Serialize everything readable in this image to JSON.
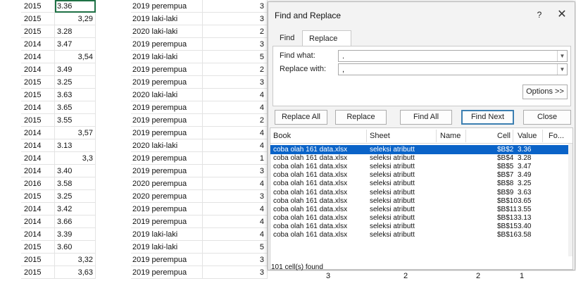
{
  "spreadsheet": {
    "rows": [
      {
        "a": "2015",
        "b": "3.36",
        "b_align": "left",
        "d": "2019 perempua",
        "e": "3"
      },
      {
        "a": "2015",
        "b": "3,29",
        "b_align": "right",
        "d": "2019 laki-laki",
        "e": "3"
      },
      {
        "a": "2015",
        "b": "3.28",
        "b_align": "left",
        "d": "2020 laki-laki",
        "e": "2"
      },
      {
        "a": "2014",
        "b": "3.47",
        "b_align": "left",
        "d": "2019 perempua",
        "e": "3"
      },
      {
        "a": "2014",
        "b": "3,54",
        "b_align": "right",
        "d": "2019 laki-laki",
        "e": "5"
      },
      {
        "a": "2014",
        "b": "3.49",
        "b_align": "left",
        "d": "2019 perempua",
        "e": "2"
      },
      {
        "a": "2015",
        "b": "3.25",
        "b_align": "left",
        "d": "2019 perempua",
        "e": "3"
      },
      {
        "a": "2015",
        "b": "3.63",
        "b_align": "left",
        "d": "2020 laki-laki",
        "e": "4"
      },
      {
        "a": "2014",
        "b": "3.65",
        "b_align": "left",
        "d": "2019 perempua",
        "e": "4"
      },
      {
        "a": "2015",
        "b": "3.55",
        "b_align": "left",
        "d": "2019 perempua",
        "e": "2"
      },
      {
        "a": "2014",
        "b": "3,57",
        "b_align": "right",
        "d": "2019 perempua",
        "e": "4"
      },
      {
        "a": "2014",
        "b": "3.13",
        "b_align": "left",
        "d": "2020 laki-laki",
        "e": "4"
      },
      {
        "a": "2014",
        "b": "3,3",
        "b_align": "right",
        "d": "2019 perempua",
        "e": "1"
      },
      {
        "a": "2014",
        "b": "3.40",
        "b_align": "left",
        "d": "2019 perempua",
        "e": "3"
      },
      {
        "a": "2016",
        "b": "3.58",
        "b_align": "left",
        "d": "2020 perempua",
        "e": "4"
      },
      {
        "a": "2015",
        "b": "3.25",
        "b_align": "left",
        "d": "2020 perempua",
        "e": "3"
      },
      {
        "a": "2014",
        "b": "3.42",
        "b_align": "left",
        "d": "2019 perempua",
        "e": "4"
      },
      {
        "a": "2014",
        "b": "3.66",
        "b_align": "left",
        "d": "2019 perempua",
        "e": "4"
      },
      {
        "a": "2014",
        "b": "3.39",
        "b_align": "left",
        "d": "2019 laki-laki",
        "e": "4"
      },
      {
        "a": "2015",
        "b": "3.60",
        "b_align": "left",
        "d": "2019 laki-laki",
        "e": "5"
      },
      {
        "a": "2015",
        "b": "3,32",
        "b_align": "right",
        "d": "2019 perempua",
        "e": "3"
      },
      {
        "a": "2015",
        "b": "3,63",
        "b_align": "right",
        "d": "2019 perempua",
        "e": "3"
      }
    ],
    "bottom_row_values": [
      "3",
      "2",
      "2",
      "1"
    ]
  },
  "dialog": {
    "title": "Find and Replace",
    "help_label": "?",
    "close_label": "✕",
    "tabs": [
      {
        "label": "Find",
        "active": false
      },
      {
        "label": "Replace",
        "active": true
      }
    ],
    "find_what_label": "Find what:",
    "find_what_value": ".",
    "replace_with_label": "Replace with:",
    "replace_with_value": ",",
    "options_label": "Options >>",
    "buttons": {
      "replace_all": "Replace All",
      "replace": "Replace",
      "find_all": "Find All",
      "find_next": "Find Next",
      "close": "Close"
    },
    "results": {
      "columns": [
        "Book",
        "Sheet",
        "Name",
        "Cell",
        "Value",
        "Fo..."
      ],
      "rows": [
        {
          "book": "coba olah 161 data.xlsx",
          "sheet": "seleksi atributt",
          "name": "",
          "cell": "$B$2",
          "value": "3.36",
          "selected": true
        },
        {
          "book": "coba olah 161 data.xlsx",
          "sheet": "seleksi atributt",
          "name": "",
          "cell": "$B$4",
          "value": "3.28",
          "selected": false
        },
        {
          "book": "coba olah 161 data.xlsx",
          "sheet": "seleksi atributt",
          "name": "",
          "cell": "$B$5",
          "value": "3.47",
          "selected": false
        },
        {
          "book": "coba olah 161 data.xlsx",
          "sheet": "seleksi atributt",
          "name": "",
          "cell": "$B$7",
          "value": "3.49",
          "selected": false
        },
        {
          "book": "coba olah 161 data.xlsx",
          "sheet": "seleksi atributt",
          "name": "",
          "cell": "$B$8",
          "value": "3.25",
          "selected": false
        },
        {
          "book": "coba olah 161 data.xlsx",
          "sheet": "seleksi atributt",
          "name": "",
          "cell": "$B$9",
          "value": "3.63",
          "selected": false
        },
        {
          "book": "coba olah 161 data.xlsx",
          "sheet": "seleksi atributt",
          "name": "",
          "cell": "$B$10",
          "value": "3.65",
          "selected": false
        },
        {
          "book": "coba olah 161 data.xlsx",
          "sheet": "seleksi atributt",
          "name": "",
          "cell": "$B$11",
          "value": "3.55",
          "selected": false
        },
        {
          "book": "coba olah 161 data.xlsx",
          "sheet": "seleksi atributt",
          "name": "",
          "cell": "$B$13",
          "value": "3.13",
          "selected": false
        },
        {
          "book": "coba olah 161 data.xlsx",
          "sheet": "seleksi atributt",
          "name": "",
          "cell": "$B$15",
          "value": "3.40",
          "selected": false
        },
        {
          "book": "coba olah 161 data.xlsx",
          "sheet": "seleksi atributt",
          "name": "",
          "cell": "$B$16",
          "value": "3.58",
          "selected": false
        }
      ],
      "status": "101 cell(s) found"
    }
  },
  "colors": {
    "selection": "#0a63c8",
    "active_cell_border": "#1e7145",
    "primary_button_border": "#3c7fb1"
  }
}
